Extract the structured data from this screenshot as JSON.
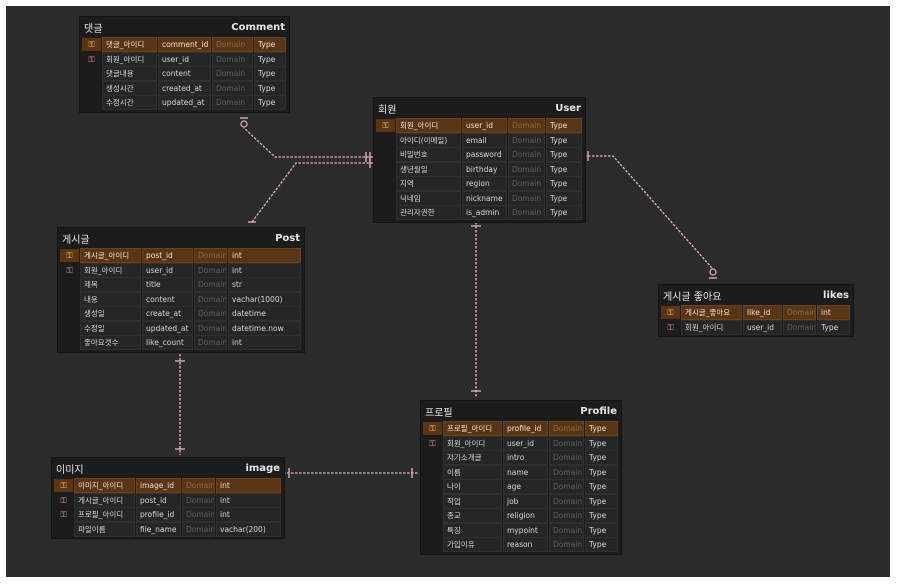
{
  "entities": {
    "comment": {
      "logical": "댓글",
      "physical": "Comment",
      "columns": [
        {
          "key": "pk",
          "l": "댓글_아이디",
          "p": "comment_id",
          "d": "Domain",
          "t": "Type"
        },
        {
          "key": "fk",
          "l": "회원_아이디",
          "p": "user_id",
          "d": "Domain",
          "t": "Type"
        },
        {
          "key": "",
          "l": "댓글내용",
          "p": "content",
          "d": "Domain",
          "t": "Type"
        },
        {
          "key": "",
          "l": "생성시간",
          "p": "created_at",
          "d": "Domain",
          "t": "Type"
        },
        {
          "key": "",
          "l": "수정시간",
          "p": "updated_at",
          "d": "Domain",
          "t": "Type"
        }
      ]
    },
    "user": {
      "logical": "회원",
      "physical": "User",
      "columns": [
        {
          "key": "pk",
          "l": "회원_아이디",
          "p": "user_id",
          "d": "Domain",
          "t": "Type"
        },
        {
          "key": "",
          "l": "아이디(이메일)",
          "p": "email",
          "d": "Domain",
          "t": "Type"
        },
        {
          "key": "",
          "l": "비밀번호",
          "p": "password",
          "d": "Domain",
          "t": "Type"
        },
        {
          "key": "",
          "l": "생년월일",
          "p": "birthday",
          "d": "Domain",
          "t": "Type"
        },
        {
          "key": "",
          "l": "지역",
          "p": "region",
          "d": "Domain",
          "t": "Type"
        },
        {
          "key": "",
          "l": "닉네임",
          "p": "nickname",
          "d": "Domain",
          "t": "Type"
        },
        {
          "key": "",
          "l": "관리자권한",
          "p": "is_admin",
          "d": "Domain",
          "t": "Type"
        }
      ]
    },
    "post": {
      "logical": "게시글",
      "physical": "Post",
      "columns": [
        {
          "key": "pk",
          "l": "게시글_아이디",
          "p": "post_id",
          "d": "Domain",
          "t": "int"
        },
        {
          "key": "fk",
          "l": "회원_아이디",
          "p": "user_id",
          "d": "Domain",
          "t": "int"
        },
        {
          "key": "",
          "l": "제목",
          "p": "title",
          "d": "Domain",
          "t": "str"
        },
        {
          "key": "",
          "l": "내용",
          "p": "content",
          "d": "Domain",
          "t": "vachar(1000)"
        },
        {
          "key": "",
          "l": "생성일",
          "p": "create_at",
          "d": "Domain",
          "t": "datetime"
        },
        {
          "key": "",
          "l": "수정일",
          "p": "updated_at",
          "d": "Domain",
          "t": "datetime.now"
        },
        {
          "key": "",
          "l": "좋아요갯수",
          "p": "like_count",
          "d": "Domain",
          "t": "int"
        }
      ]
    },
    "likes": {
      "logical": "게시글 좋아요",
      "physical": "likes",
      "columns": [
        {
          "key": "pk",
          "l": "게시글_좋아요",
          "p": "like_id",
          "d": "Domain",
          "t": "int"
        },
        {
          "key": "fk",
          "l": "회원_아이디",
          "p": "user_id",
          "d": "Domain",
          "t": "Type"
        }
      ]
    },
    "image": {
      "logical": "이미지",
      "physical": "image",
      "columns": [
        {
          "key": "pk",
          "l": "이미지_아이디",
          "p": "image_id",
          "d": "Domain",
          "t": "int"
        },
        {
          "key": "fk",
          "l": "게시글_아이디",
          "p": "post_id",
          "d": "Domain",
          "t": "int"
        },
        {
          "key": "fk",
          "l": "프로필_아이디",
          "p": "profile_id",
          "d": "Domain",
          "t": "int"
        },
        {
          "key": "",
          "l": "파일이름",
          "p": "file_name",
          "d": "Domain",
          "t": "vachar(200)"
        }
      ]
    },
    "profile": {
      "logical": "프로필",
      "physical": "Profile",
      "columns": [
        {
          "key": "pk",
          "l": "프로필_아이디",
          "p": "profile_id",
          "d": "Domain",
          "t": "Type"
        },
        {
          "key": "fk",
          "l": "회원_아이디",
          "p": "user_id",
          "d": "Domain",
          "t": "Type"
        },
        {
          "key": "",
          "l": "자기소개글",
          "p": "intro",
          "d": "Domain",
          "t": "Type"
        },
        {
          "key": "",
          "l": "이름",
          "p": "name",
          "d": "Domain",
          "t": "Type"
        },
        {
          "key": "",
          "l": "나이",
          "p": "age",
          "d": "Domain",
          "t": "Type"
        },
        {
          "key": "",
          "l": "직업",
          "p": "job",
          "d": "Domain",
          "t": "Type"
        },
        {
          "key": "",
          "l": "종교",
          "p": "religion",
          "d": "Domain",
          "t": "Type"
        },
        {
          "key": "",
          "l": "특징",
          "p": "mypoint",
          "d": "Domain",
          "t": "Type"
        },
        {
          "key": "",
          "l": "가입이유",
          "p": "reason",
          "d": "Domain",
          "t": "Type"
        }
      ]
    }
  },
  "key_icons": {
    "pk": "primary-key-icon",
    "fk": "foreign-key-icon"
  },
  "colors": {
    "background": "#2b2b2b",
    "entity": "#1c1c1c",
    "pk_row": "#5a3515",
    "relation": "#e8b4bc"
  }
}
